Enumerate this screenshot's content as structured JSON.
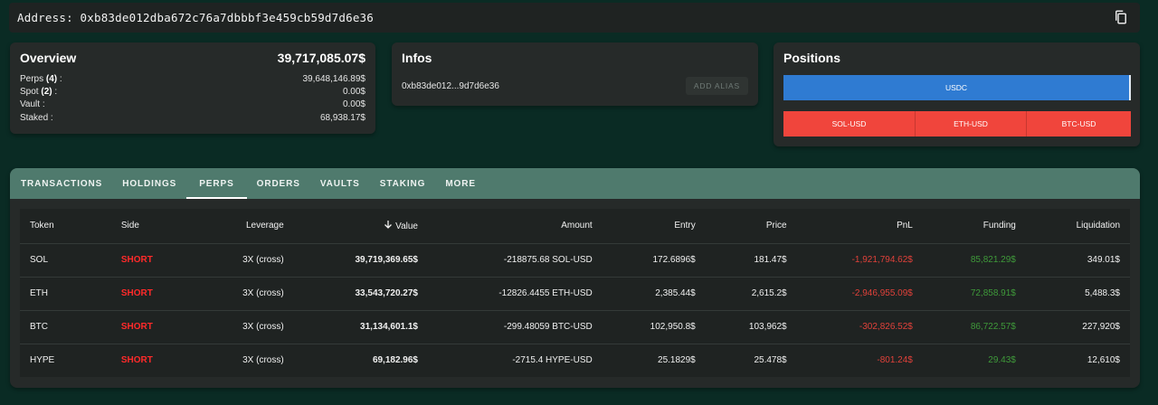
{
  "address_bar": {
    "text": "Address: 0xb83de012dba672c76a7dbbbf3e459cb59d7d6e36",
    "copy_icon": "copy-icon"
  },
  "overview": {
    "title": "Overview",
    "total": "39,717,085.07$",
    "rows": [
      {
        "label_pre": "Perps ",
        "label_count": "(4)",
        "label_post": " :",
        "value": "39,648,146.89$"
      },
      {
        "label_pre": "Spot ",
        "label_count": "(2)",
        "label_post": " :",
        "value": "0.00$"
      },
      {
        "label_pre": "Vault :",
        "label_count": "",
        "label_post": "",
        "value": "0.00$"
      },
      {
        "label_pre": "Staked :",
        "label_count": "",
        "label_post": "",
        "value": "68,938.17$"
      }
    ]
  },
  "infos": {
    "title": "Infos",
    "address": "0xb83de012...9d7d6e36",
    "alias_button": "ADD ALIAS"
  },
  "positions": {
    "title": "Positions",
    "long_label": "USDC",
    "shorts": [
      "SOL-USD",
      "ETH-USD",
      "BTC-USD"
    ],
    "colors": {
      "long": "#2f7bd2",
      "short": "#f0453c"
    }
  },
  "tabs": [
    "TRANSACTIONS",
    "HOLDINGS",
    "PERPS",
    "ORDERS",
    "VAULTS",
    "STAKING",
    "MORE"
  ],
  "active_tab": "PERPS",
  "table": {
    "headers": {
      "token": "Token",
      "side": "Side",
      "leverage": "Leverage",
      "value": "Value",
      "amount": "Amount",
      "entry": "Entry",
      "price": "Price",
      "pnl": "PnL",
      "funding": "Funding",
      "liquidation": "Liquidation"
    },
    "sort_icon": "arrow-down-icon",
    "rows": [
      {
        "token": "SOL",
        "side": "SHORT",
        "leverage": "3X (cross)",
        "value": "39,719,369.65$",
        "amount": "-218875.68 SOL-USD",
        "entry": "172.6896$",
        "price": "181.47$",
        "pnl": "-1,921,794.62$",
        "funding": "85,821.29$",
        "liquidation": "349.01$"
      },
      {
        "token": "ETH",
        "side": "SHORT",
        "leverage": "3X (cross)",
        "value": "33,543,720.27$",
        "amount": "-12826.4455 ETH-USD",
        "entry": "2,385.44$",
        "price": "2,615.2$",
        "pnl": "-2,946,955.09$",
        "funding": "72,858.91$",
        "liquidation": "5,488.3$"
      },
      {
        "token": "BTC",
        "side": "SHORT",
        "leverage": "3X (cross)",
        "value": "31,134,601.1$",
        "amount": "-299.48059 BTC-USD",
        "entry": "102,950.8$",
        "price": "103,962$",
        "pnl": "-302,826.52$",
        "funding": "86,722.57$",
        "liquidation": "227,920$"
      },
      {
        "token": "HYPE",
        "side": "SHORT",
        "leverage": "3X (cross)",
        "value": "69,182.96$",
        "amount": "-2715.4 HYPE-USD",
        "entry": "25.1829$",
        "price": "25.478$",
        "pnl": "-801.24$",
        "funding": "29.43$",
        "liquidation": "12,610$"
      }
    ]
  }
}
